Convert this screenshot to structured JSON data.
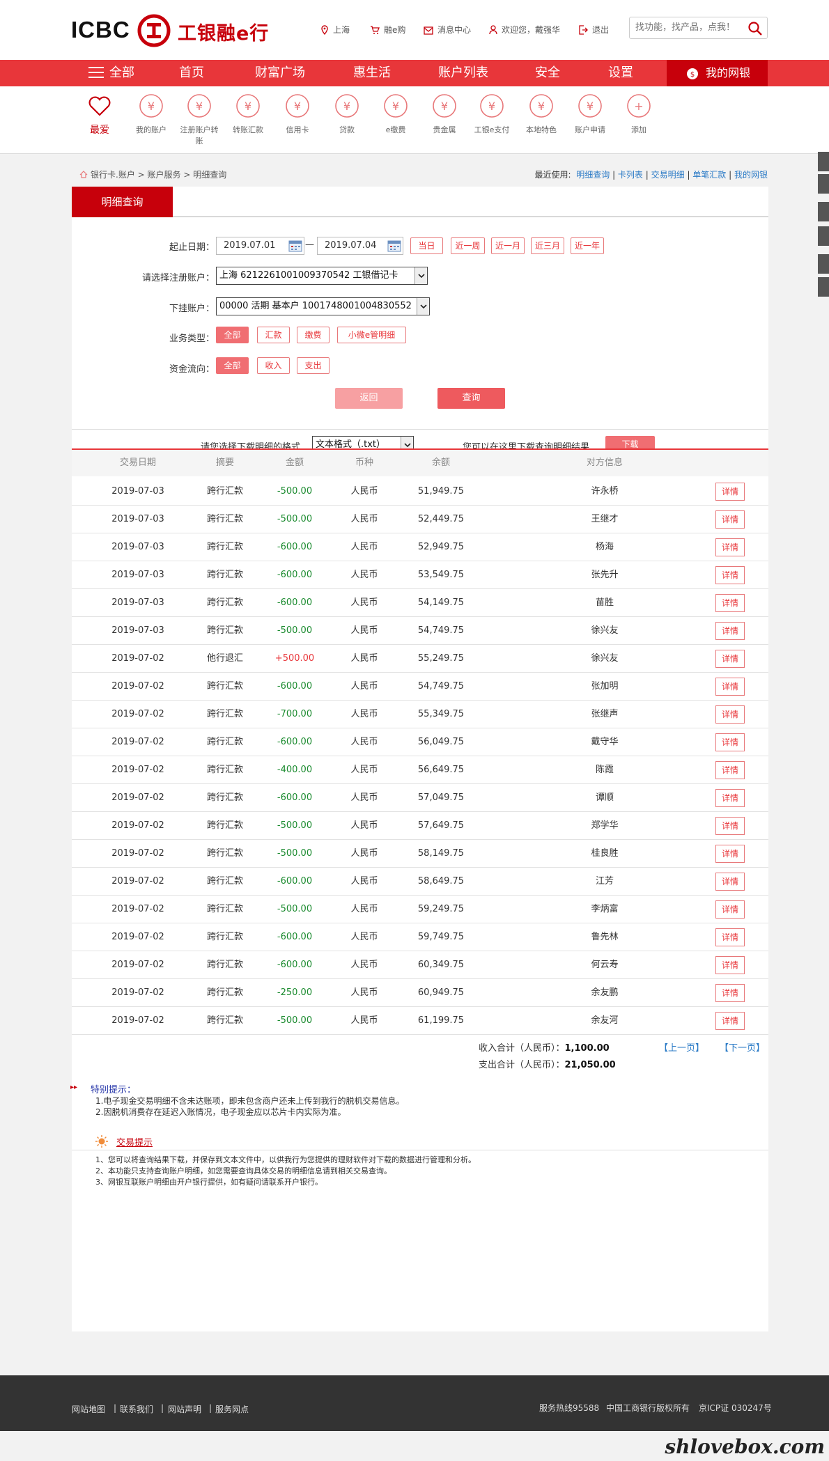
{
  "header": {
    "logo_en": "ICBC",
    "logo_cn": "工银融e行",
    "links": {
      "location": "上海",
      "shop": "融e购",
      "messages": "消息中心",
      "welcome": "欢迎您，戴强华",
      "logout": "退出"
    },
    "search_placeholder": "找功能，找产品，点我！"
  },
  "nav": {
    "all": "全部",
    "items": [
      "首页",
      "财富广场",
      "惠生活",
      "账户列表",
      "安全",
      "设置"
    ],
    "my_bank": "我的网银"
  },
  "quick_icons": {
    "favorite": "最爱",
    "items": [
      {
        "label": "我的账户",
        "icon": "yen-circle-icon"
      },
      {
        "label": "注册账户转账",
        "icon": "transfer-icon"
      },
      {
        "label": "转账汇款",
        "icon": "remit-icon"
      },
      {
        "label": "信用卡",
        "icon": "credit-card-icon"
      },
      {
        "label": "贷款",
        "icon": "money-bag-icon"
      },
      {
        "label": "e缴费",
        "icon": "drop-icon"
      },
      {
        "label": "贵金属",
        "icon": "gold-bars-icon"
      },
      {
        "label": "工银e支付",
        "icon": "epay-icon"
      },
      {
        "label": "本地特色",
        "icon": "local-icon"
      },
      {
        "label": "账户申请",
        "icon": "apply-icon"
      },
      {
        "label": "添加",
        "icon": "plus-icon"
      }
    ]
  },
  "breadcrumb": {
    "parts": [
      "银行卡.账户",
      "账户服务",
      "明细查询"
    ]
  },
  "recent": {
    "label": "最近使用:",
    "links": [
      "明细查询",
      "卡列表",
      "交易明细",
      "单笔汇款",
      "我的网银"
    ]
  },
  "tab": "明细查询",
  "form": {
    "date_label": "起止日期：",
    "start_date": "2019.07.01",
    "end_date": "2019.07.04",
    "quick_ranges": [
      "当日",
      "近一周",
      "近一月",
      "近三月",
      "近一年"
    ],
    "account_label": "请选择注册账户：",
    "account_value": "上海 6212261001009370542 工银借记卡",
    "sub_label": "下挂账户：",
    "sub_value": "00000 活期 基本户 1001748001004830552",
    "biz_label": "业务类型：",
    "biz_options": [
      "全部",
      "汇款",
      "缴费",
      "小微e管明细"
    ],
    "flow_label": "资金流向：",
    "flow_options": [
      "全部",
      "收入",
      "支出"
    ],
    "back_button": "返回",
    "query_button": "查询"
  },
  "download": {
    "format_label": "请您选择下载明细的格式",
    "format_value": "文本格式（.txt）",
    "hint": "您可以在这里下载查询明细结果",
    "button": "下载"
  },
  "table": {
    "headers": [
      "交易日期",
      "摘要",
      "金额",
      "币种",
      "余额",
      "对方信息"
    ],
    "detail_label": "详情",
    "rows": [
      {
        "date": "2019-07-03",
        "summary": "跨行汇款",
        "amount": "-500.00",
        "currency": "人民币",
        "balance": "51,949.75",
        "party": "许永桥"
      },
      {
        "date": "2019-07-03",
        "summary": "跨行汇款",
        "amount": "-500.00",
        "currency": "人民币",
        "balance": "52,449.75",
        "party": "王继才"
      },
      {
        "date": "2019-07-03",
        "summary": "跨行汇款",
        "amount": "-600.00",
        "currency": "人民币",
        "balance": "52,949.75",
        "party": "杨海"
      },
      {
        "date": "2019-07-03",
        "summary": "跨行汇款",
        "amount": "-600.00",
        "currency": "人民币",
        "balance": "53,549.75",
        "party": "张先升"
      },
      {
        "date": "2019-07-03",
        "summary": "跨行汇款",
        "amount": "-600.00",
        "currency": "人民币",
        "balance": "54,149.75",
        "party": "苗胜"
      },
      {
        "date": "2019-07-03",
        "summary": "跨行汇款",
        "amount": "-500.00",
        "currency": "人民币",
        "balance": "54,749.75",
        "party": "徐兴友"
      },
      {
        "date": "2019-07-02",
        "summary": "他行退汇",
        "amount": "+500.00",
        "currency": "人民币",
        "balance": "55,249.75",
        "party": "徐兴友"
      },
      {
        "date": "2019-07-02",
        "summary": "跨行汇款",
        "amount": "-600.00",
        "currency": "人民币",
        "balance": "54,749.75",
        "party": "张加明"
      },
      {
        "date": "2019-07-02",
        "summary": "跨行汇款",
        "amount": "-700.00",
        "currency": "人民币",
        "balance": "55,349.75",
        "party": "张继声"
      },
      {
        "date": "2019-07-02",
        "summary": "跨行汇款",
        "amount": "-600.00",
        "currency": "人民币",
        "balance": "56,049.75",
        "party": "戴守华"
      },
      {
        "date": "2019-07-02",
        "summary": "跨行汇款",
        "amount": "-400.00",
        "currency": "人民币",
        "balance": "56,649.75",
        "party": "陈霞"
      },
      {
        "date": "2019-07-02",
        "summary": "跨行汇款",
        "amount": "-600.00",
        "currency": "人民币",
        "balance": "57,049.75",
        "party": "谭顺"
      },
      {
        "date": "2019-07-02",
        "summary": "跨行汇款",
        "amount": "-500.00",
        "currency": "人民币",
        "balance": "57,649.75",
        "party": "郑学华"
      },
      {
        "date": "2019-07-02",
        "summary": "跨行汇款",
        "amount": "-500.00",
        "currency": "人民币",
        "balance": "58,149.75",
        "party": "桂良胜"
      },
      {
        "date": "2019-07-02",
        "summary": "跨行汇款",
        "amount": "-600.00",
        "currency": "人民币",
        "balance": "58,649.75",
        "party": "江芳"
      },
      {
        "date": "2019-07-02",
        "summary": "跨行汇款",
        "amount": "-500.00",
        "currency": "人民币",
        "balance": "59,249.75",
        "party": "李炳富"
      },
      {
        "date": "2019-07-02",
        "summary": "跨行汇款",
        "amount": "-600.00",
        "currency": "人民币",
        "balance": "59,749.75",
        "party": "鲁先林"
      },
      {
        "date": "2019-07-02",
        "summary": "跨行汇款",
        "amount": "-600.00",
        "currency": "人民币",
        "balance": "60,349.75",
        "party": "何云寿"
      },
      {
        "date": "2019-07-02",
        "summary": "跨行汇款",
        "amount": "-250.00",
        "currency": "人民币",
        "balance": "60,949.75",
        "party": "余友鹏"
      },
      {
        "date": "2019-07-02",
        "summary": "跨行汇款",
        "amount": "-500.00",
        "currency": "人民币",
        "balance": "61,199.75",
        "party": "余友河"
      }
    ]
  },
  "totals": {
    "income_label": "收入合计（人民币）：",
    "income_value": "1,100.00",
    "expense_label": "支出合计（人民币）：",
    "expense_value": "21,050.00",
    "prev_page": "【上一页】",
    "next_page": "【下一页】"
  },
  "notice": {
    "title": "特别提示：",
    "lines": [
      "1.电子现金交易明细不含未达账项，即未包含商户还未上传到我行的脱机交易信息。",
      "2.因脱机消费存在延迟入账情况，电子现金应以芯片卡内实际为准。"
    ]
  },
  "tips": {
    "title": "交易提示",
    "lines": [
      "1、您可以将查询结果下载，并保存到文本文件中，以供我行为您提供的理财软件对下载的数据进行管理和分析。",
      "2、本功能只支持查询账户明细，如您需要查询具体交易的明细信息请到相关交易查询。",
      "3、网银互联账户明细由开户银行提供，如有疑问请联系开户银行。"
    ]
  },
  "footer": {
    "links": [
      "网站地图",
      "联系我们",
      "网站声明",
      "服务网点"
    ],
    "hotline": "服务热线95588",
    "copyright": "中国工商银行版权所有",
    "icp": "京ICP证 030247号"
  },
  "watermark": "shlovebox.com",
  "colors": {
    "brand_red": "#c7000b",
    "nav_red": "#e8363a",
    "negative_green": "#1a8a2e"
  }
}
